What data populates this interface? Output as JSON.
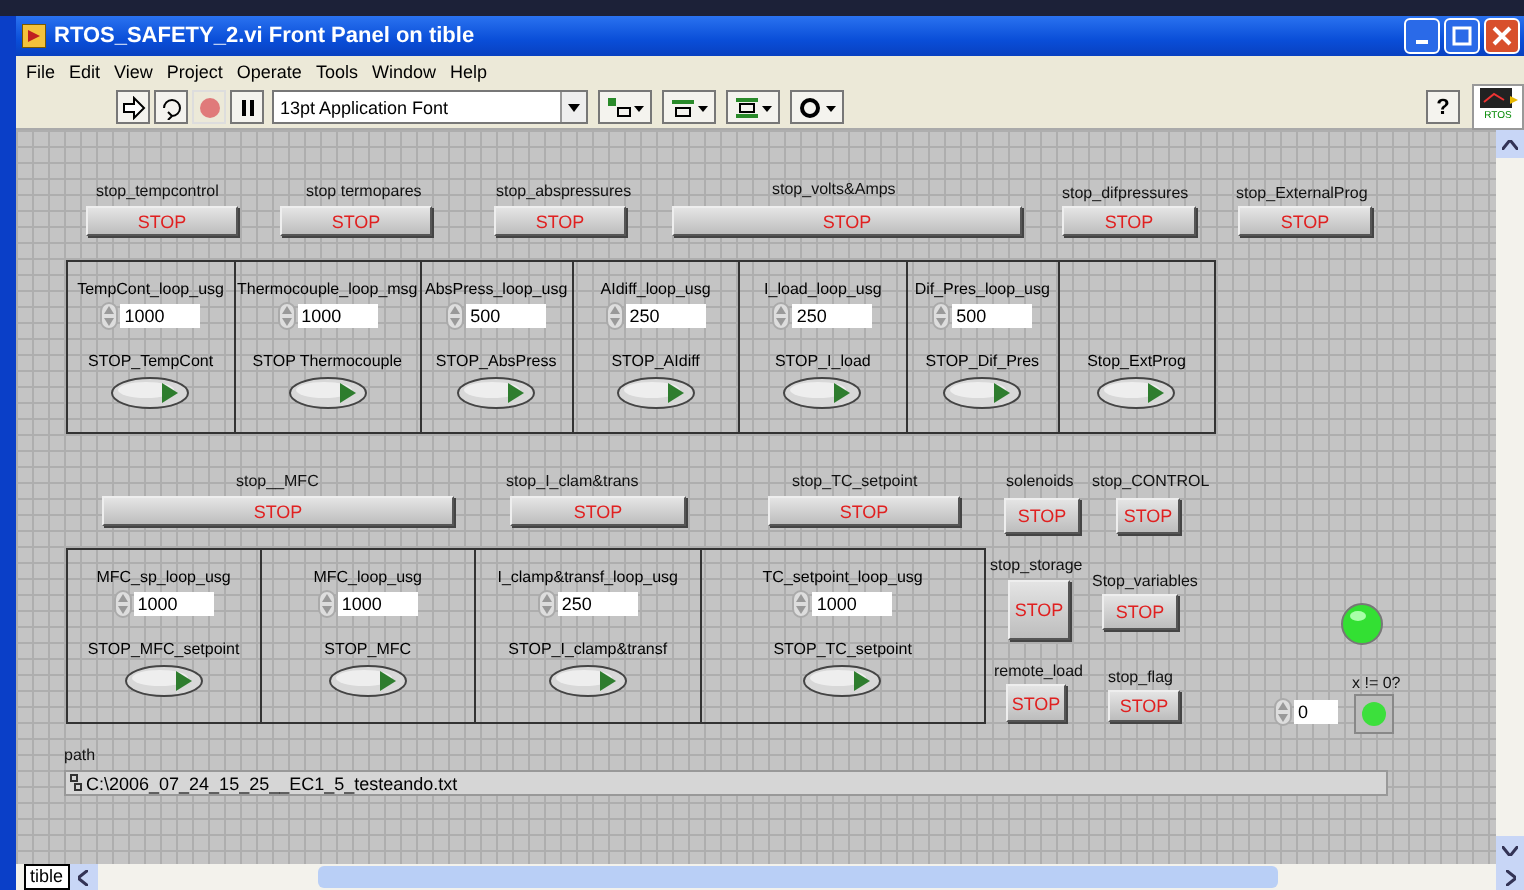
{
  "window": {
    "title": "RTOS_SAFETY_2.vi Front Panel on tible"
  },
  "menu": [
    "File",
    "Edit",
    "View",
    "Project",
    "Operate",
    "Tools",
    "Window",
    "Help"
  ],
  "toolbar": {
    "font": "13pt Application Font",
    "help": "?",
    "vi_icon_text": "RTOS"
  },
  "stop_buttons": [
    {
      "label": "stop_tempcontrol",
      "text": "STOP"
    },
    {
      "label": "stop termopares",
      "text": "STOP"
    },
    {
      "label": "stop_abspressures",
      "text": "STOP"
    },
    {
      "label": "stop_volts&Amps",
      "text": "STOP"
    },
    {
      "label": "stop_difpressures",
      "text": "STOP"
    },
    {
      "label": "stop_ExternalProg",
      "text": "STOP"
    },
    {
      "label": "stop__MFC",
      "text": "STOP"
    },
    {
      "label": "stop_I_clam&trans",
      "text": "STOP"
    },
    {
      "label": "stop_TC_setpoint",
      "text": "STOP"
    },
    {
      "label": "solenoids",
      "text": "STOP"
    },
    {
      "label": "stop_CONTROL",
      "text": "STOP"
    },
    {
      "label": "stop_storage",
      "text": "STOP"
    },
    {
      "label": "Stop_variables",
      "text": "STOP"
    },
    {
      "label": "remote_load",
      "text": "STOP"
    },
    {
      "label": "stop_flag",
      "text": "STOP"
    }
  ],
  "loop_groups": [
    {
      "cells": [
        {
          "label": "TempCont_loop_usg",
          "value": "1000",
          "stop_label": "STOP_TempCont",
          "on": false
        },
        {
          "label": "Thermocouple_loop_msg",
          "value": "1000",
          "stop_label": "STOP Thermocouple",
          "on": false
        },
        {
          "label": "AbsPress_loop_usg",
          "value": "500",
          "stop_label": "STOP_AbsPress",
          "on": false
        },
        {
          "label": "AIdiff_loop_usg",
          "value": "250",
          "stop_label": "STOP_AIdiff",
          "on": false
        },
        {
          "label": "I_load_loop_usg",
          "value": "250",
          "stop_label": "STOP_I_load",
          "on": false
        },
        {
          "label": "Dif_Pres_loop_usg",
          "value": "500",
          "stop_label": "STOP_Dif_Pres",
          "on": false
        },
        {
          "stop_label": "Stop_ExtProg",
          "on": false
        }
      ]
    },
    {
      "cells": [
        {
          "label": "MFC_sp_loop_usg",
          "value": "1000",
          "stop_label": "STOP_MFC_setpoint",
          "on": false
        },
        {
          "label": "MFC_loop_usg",
          "value": "1000",
          "stop_label": "STOP_MFC",
          "on": false
        },
        {
          "label": "I_clamp&transf_loop_usg",
          "value": "250",
          "stop_label": "STOP_I_clamp&transf",
          "on": false
        },
        {
          "label": "TC_setpoint_loop_usg",
          "value": "1000",
          "stop_label": "STOP_TC_setpoint",
          "on": false
        }
      ]
    }
  ],
  "indicator": {
    "led_on": true,
    "label": "x != 0?",
    "value": "0",
    "result_on": true
  },
  "path": {
    "label": "path",
    "value": "C:\\2006_07_24_15_25__EC1_5_testeando.txt"
  },
  "target_tab": "tible"
}
